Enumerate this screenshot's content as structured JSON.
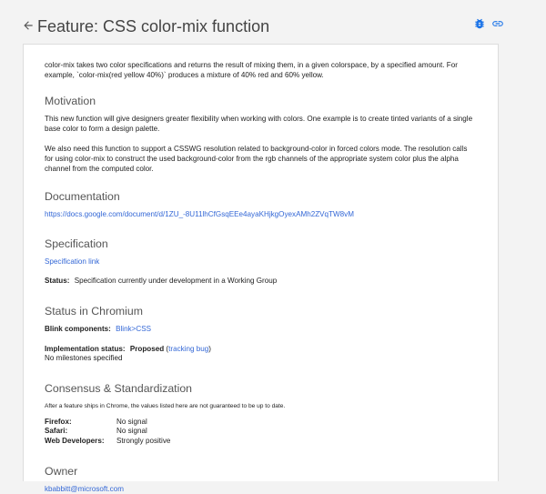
{
  "header": {
    "title": "Feature: CSS color-mix function"
  },
  "summary": "color-mix takes two color specifications and returns the result of mixing them, in a given colorspace, by a specified amount. For example, `color-mix(red yellow 40%)` produces a mixture of 40% red and 60% yellow.",
  "motivation": {
    "heading": "Motivation",
    "paragraphs": [
      "This new function will give designers greater flexibility when working with colors. One example is to create tinted variants of a single base color to form a design palette.",
      "We also need this function to support a CSSWG resolution related to background-color in forced colors mode. The resolution calls for using color-mix to construct the used background-color from the rgb channels of the appropriate system color plus the alpha channel from the computed color."
    ]
  },
  "documentation": {
    "heading": "Documentation",
    "link": "https://docs.google.com/document/d/1ZU_-8U11lhCfGsqEEe4ayaKHjkgOyexAMh2ZVqTW8vM"
  },
  "specification": {
    "heading": "Specification",
    "link": "Specification link",
    "status_label": "Status:",
    "status_value": "Specification currently under development in a Working Group"
  },
  "chromium": {
    "heading": "Status in Chromium",
    "blink_label": "Blink components:",
    "blink_value": "Blink>CSS",
    "impl_label": "Implementation status:",
    "impl_value": "Proposed",
    "tracking_open": "(",
    "tracking_link": "tracking bug",
    "tracking_close": ")",
    "milestones": "No milestones specified"
  },
  "consensus": {
    "heading": "Consensus & Standardization",
    "note": "After a feature ships in Chrome, the values listed here are not guaranteed to be up to date.",
    "rows": [
      {
        "label": "Firefox:",
        "value": "No signal"
      },
      {
        "label": "Safari:",
        "value": "No signal"
      },
      {
        "label": "Web Developers:",
        "value": "Strongly positive"
      }
    ]
  },
  "owner": {
    "heading": "Owner",
    "email": "kbabbitt@microsoft.com"
  },
  "colors": {
    "link": "#3367d6",
    "icon_blue": "#1a73e8",
    "background": "#f3f3f3"
  },
  "icons": {
    "back": "arrow-back-icon",
    "bug": "bug-icon",
    "link": "link-icon"
  }
}
